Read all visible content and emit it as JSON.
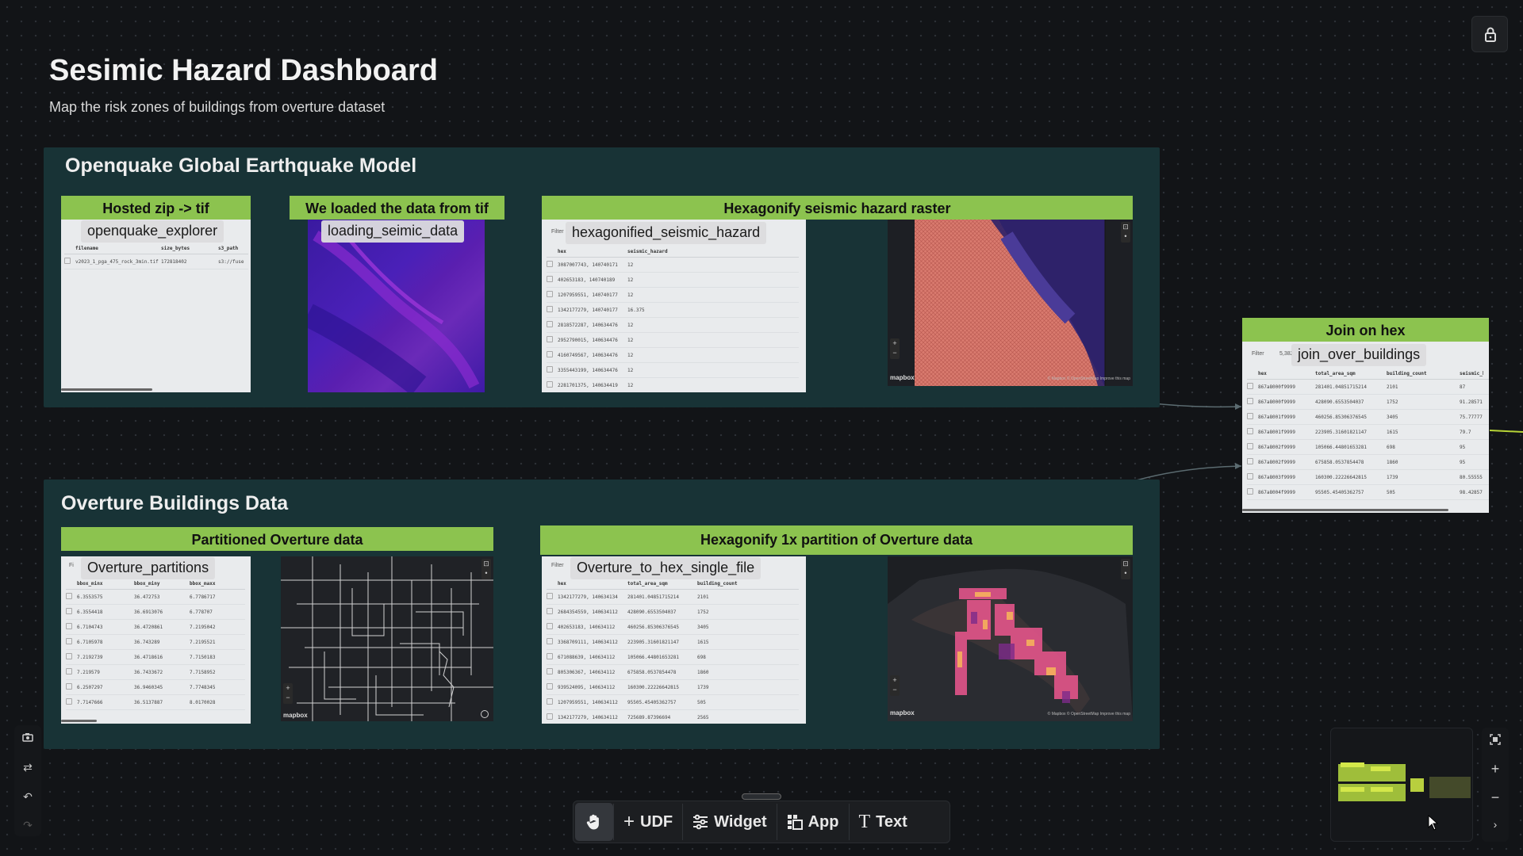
{
  "page": {
    "title": "Sesimic Hazard Dashboard",
    "subtitle": "Map the risk zones of buildings from overture dataset"
  },
  "groups": {
    "openquake": {
      "title": "Openquake Global Earthquake Model"
    },
    "overture": {
      "title": "Overture Buildings Data"
    }
  },
  "cards": {
    "hosted_zip": {
      "header": "Hosted zip -> tif",
      "udf": "openquake_explorer"
    },
    "loaded_tif": {
      "header": "We loaded the data from tif",
      "udf": "loading_seimic_data"
    },
    "hexagonify_raster": {
      "header": "Hexagonify seismic hazard raster",
      "udf": "hexagonified_seismic_hazard"
    },
    "join_hex": {
      "header": "Join on hex",
      "udf": "join_over_buildings"
    },
    "partitioned": {
      "header": "Partitioned Overture data",
      "udf": "Overture_partitions"
    },
    "hexagonify_partition": {
      "header": "Hexagonify 1x partition of Overture data",
      "udf": "Overture_to_hex_single_file"
    }
  },
  "tables": {
    "openquake_explorer": {
      "columns": [
        "filename",
        "size_bytes",
        "s3_path"
      ],
      "rows": [
        [
          "v2023_1_pga_475_rock_3min.tif",
          "172818402",
          "s3://fuse"
        ]
      ]
    },
    "hexagonified": {
      "filter": "Filter",
      "columns": [
        "hex",
        "seismic_hazard"
      ],
      "rows": [
        [
          "3087007743, 140740171",
          "12"
        ],
        [
          "402653183, 140740189",
          "12"
        ],
        [
          "1207959551, 140740177",
          "12"
        ],
        [
          "1342177279, 140740177",
          "16.375"
        ],
        [
          "2818572287, 140634476",
          "12"
        ],
        [
          "2952790015, 140634476",
          "12"
        ],
        [
          "4160749567, 140634476",
          "12"
        ],
        [
          "3355443199, 140634476",
          "12"
        ],
        [
          "2281701375, 140634419",
          "12"
        ]
      ]
    },
    "join_over": {
      "filter": "Filter",
      "count": "5,382",
      "columns": [
        "hex",
        "total_area_sqm",
        "building_count",
        "seismic_h"
      ],
      "rows": [
        [
          "867a8000f9999",
          "281401.04851715214",
          "2101",
          "87"
        ],
        [
          "867a8000f9999",
          "428090.6553504037",
          "1752",
          "91.28571"
        ],
        [
          "867a8001f9999",
          "460256.85306376545",
          "3405",
          "75.77777"
        ],
        [
          "867a8001f9999",
          "223905.31601821147",
          "1615",
          "79.7"
        ],
        [
          "867a8002f9999",
          "105066.44801653281",
          "698",
          "95"
        ],
        [
          "867a8002f9999",
          "675858.0537854478",
          "1860",
          "95"
        ],
        [
          "867a8003f9999",
          "160300.22226642815",
          "1739",
          "80.55555"
        ],
        [
          "867a8004f9999",
          "95505.45405362757",
          "505",
          "98.42857"
        ]
      ]
    },
    "overture_partitions": {
      "filter": "Fi",
      "columns": [
        "bbox_minx",
        "bbox_miny",
        "bbox_maxx"
      ],
      "rows": [
        [
          "6.3553575",
          "36.472753",
          "6.7786717"
        ],
        [
          "6.3554418",
          "36.6913076",
          "6.778707"
        ],
        [
          "6.7104743",
          "36.4720861",
          "7.2195042"
        ],
        [
          "6.7105978",
          "36.743289",
          "7.2195521"
        ],
        [
          "7.2192739",
          "36.4718616",
          "7.7150183"
        ],
        [
          "7.219579",
          "36.7433672",
          "7.7158952"
        ],
        [
          "6.2507297",
          "36.9460345",
          "7.7748345"
        ],
        [
          "7.7147666",
          "36.5137887",
          "8.0170028"
        ]
      ]
    },
    "overture_to_hex": {
      "filter": "Filter",
      "columns": [
        "hex",
        "total_area_sqm",
        "building_count"
      ],
      "rows": [
        [
          "1342177279, 140634134",
          "281401.04851715214",
          "2101"
        ],
        [
          "2684354559, 140634112",
          "428090.6553504037",
          "1752"
        ],
        [
          "402653183, 140634112",
          "460256.85306376545",
          "3405"
        ],
        [
          "3368709111, 140634112",
          "223905.31601821147",
          "1615"
        ],
        [
          "671088639, 140634112",
          "105066.44801653281",
          "698"
        ],
        [
          "805306367, 140634112",
          "675858.0537854478",
          "1860"
        ],
        [
          "939524095, 140634112",
          "160300.22226642815",
          "1739"
        ],
        [
          "1207959551, 140634112",
          "95505.45405362757",
          "505"
        ],
        [
          "1342177279, 140634112",
          "725689.87396694",
          "2565"
        ]
      ]
    }
  },
  "maps": {
    "attribution": "mapbox",
    "scale": "100 km",
    "credits": "© Mapbox © OpenStreetMap Improve this map"
  },
  "toolbar": {
    "udf": "UDF",
    "widget": "Widget",
    "app": "App",
    "text": "Text"
  },
  "icons": [
    "hand-icon",
    "plus-icon",
    "sliders-icon",
    "grid-icon",
    "text-icon",
    "lock-icon",
    "camera-icon",
    "swap-icon",
    "undo-icon",
    "redo-icon",
    "fit-icon",
    "zoom-in-icon",
    "zoom-out-icon",
    "chevron-right-icon"
  ],
  "colors": {
    "accent_green": "#8cc34f",
    "group_bg": "#183336",
    "canvas_bg": "#121417"
  }
}
